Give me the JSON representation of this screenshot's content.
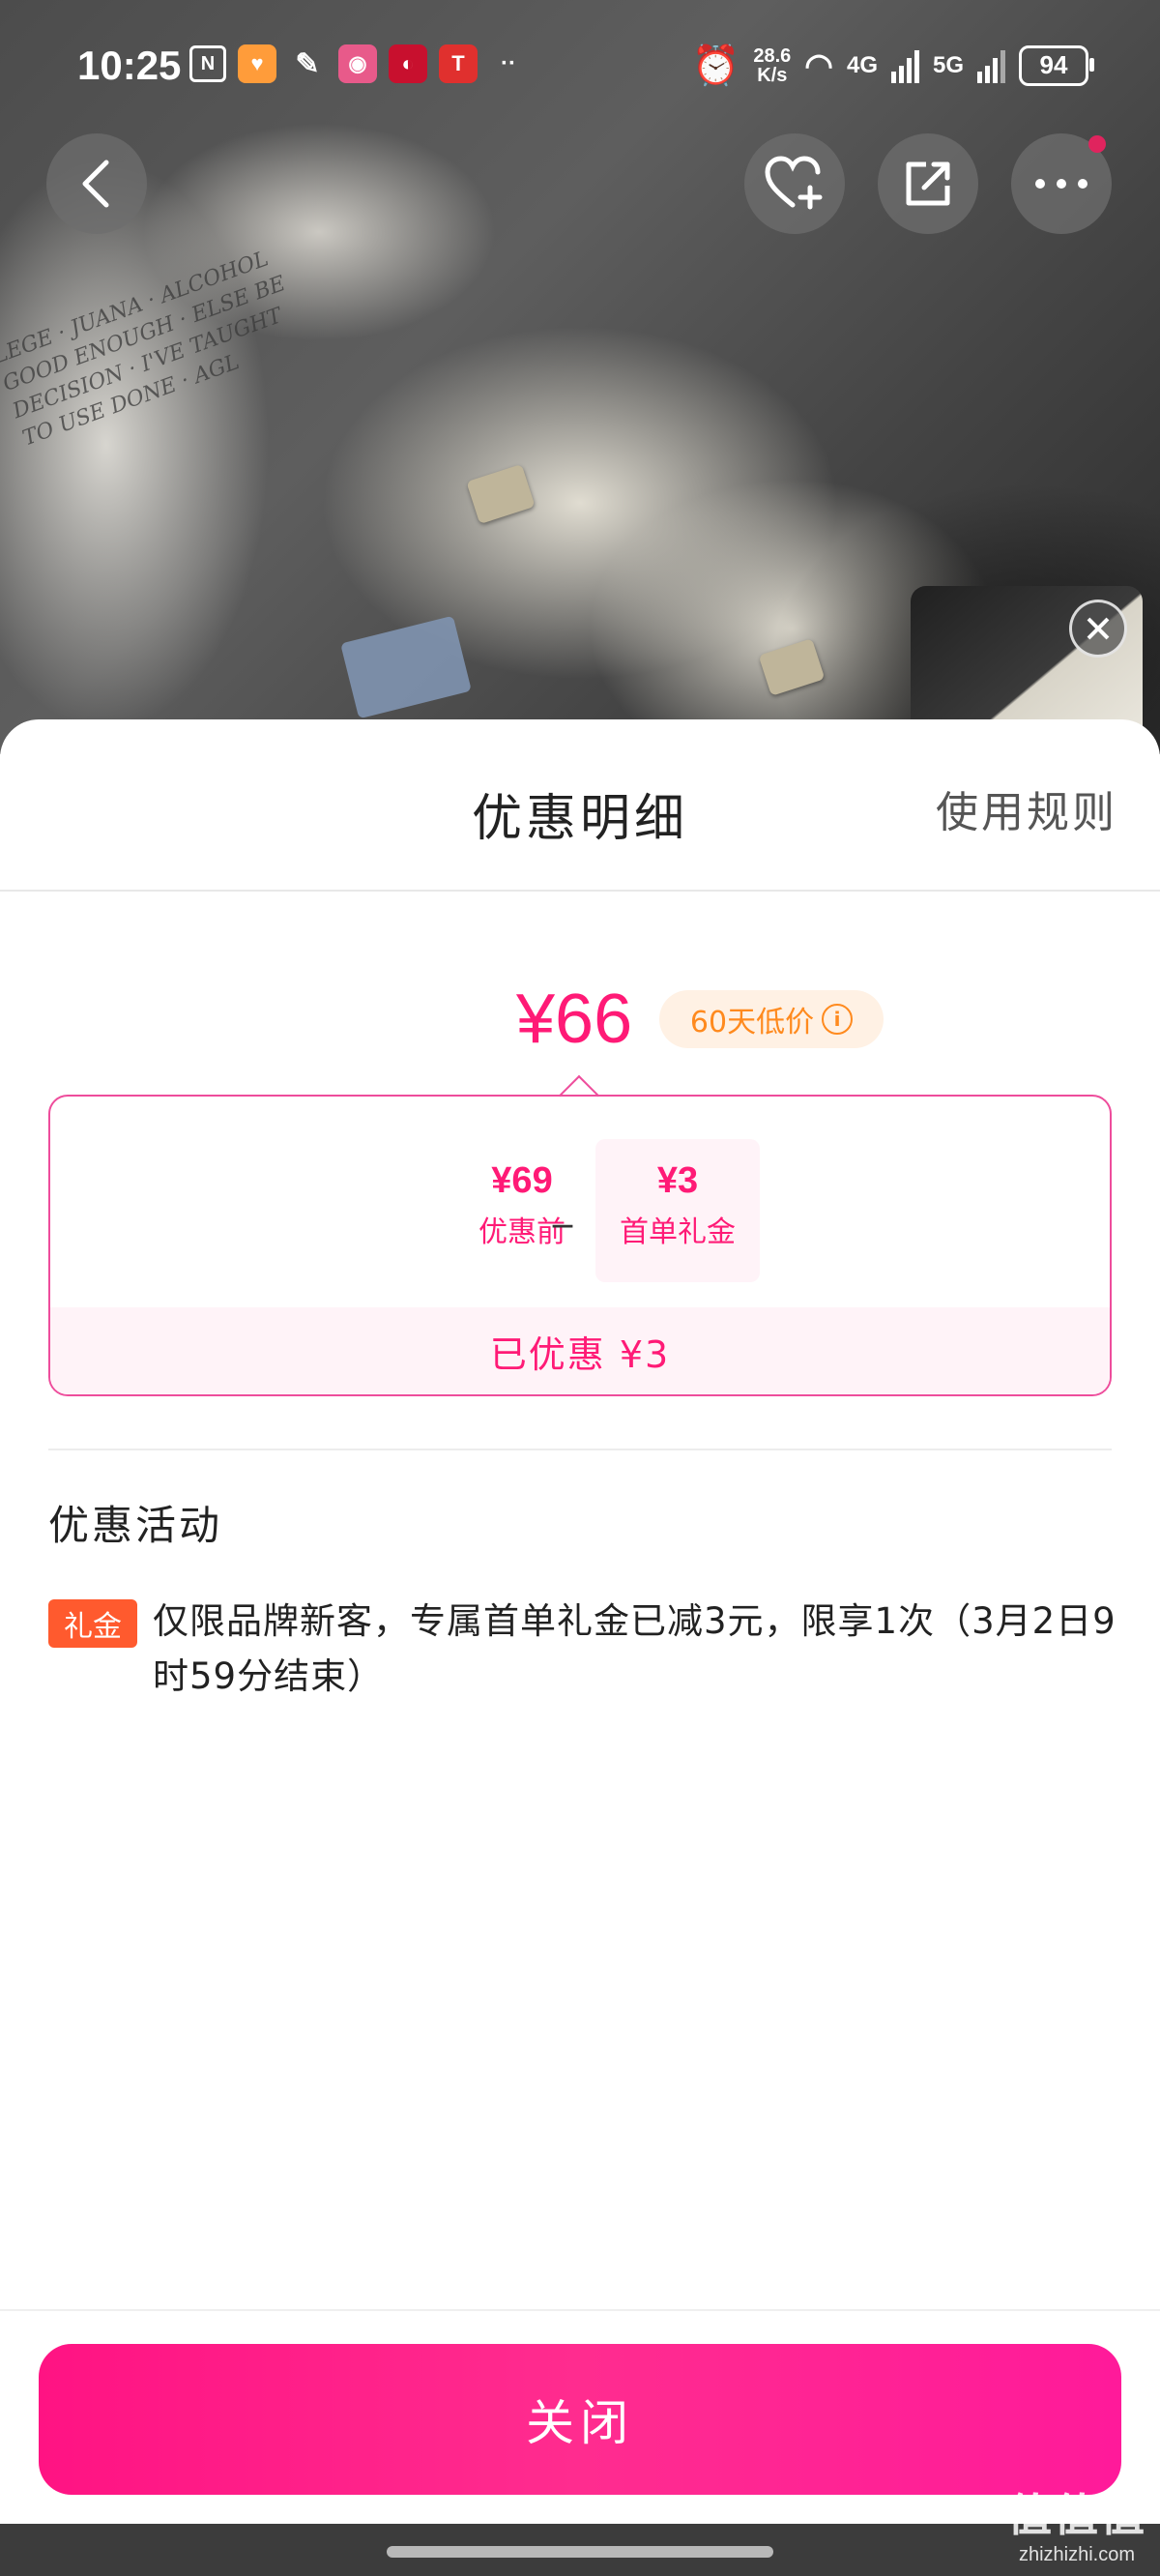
{
  "status_bar": {
    "time": "10:25",
    "netspeed_value": "28.6",
    "netspeed_unit": "K/s",
    "net_4g": "4G",
    "net_5g": "5G",
    "battery": "94"
  },
  "sheet": {
    "title": "优惠明细",
    "rules_link": "使用规则",
    "final_price": "¥66",
    "low_price_badge": "60天低价",
    "calc": {
      "original_amount": "¥69",
      "original_label": "优惠前",
      "minus": "_",
      "coupon_amount": "¥3",
      "coupon_label": "首单礼金",
      "saved_text": "已优惠 ¥3"
    },
    "section_title": "优惠活动",
    "promotion": {
      "tag": "礼金",
      "description": "仅限品牌新客，专属首单礼金已减3元，限享1次（3月2日9时59分结束）"
    },
    "close_button": "关闭"
  },
  "watermark": {
    "big": "值值值",
    "small": "zhizhizhi.com"
  },
  "icons": {
    "back": "chevron-left-icon",
    "favorite": "heart-plus-icon",
    "share": "share-icon",
    "more": "more-dots-icon",
    "info": "info-icon",
    "pip_close": "close-icon"
  },
  "colors": {
    "accent": "#ff1a76",
    "badge_bg": "#fff1e4",
    "badge_text": "#ff8a1e",
    "promo_tag": "#ff5a2e"
  }
}
